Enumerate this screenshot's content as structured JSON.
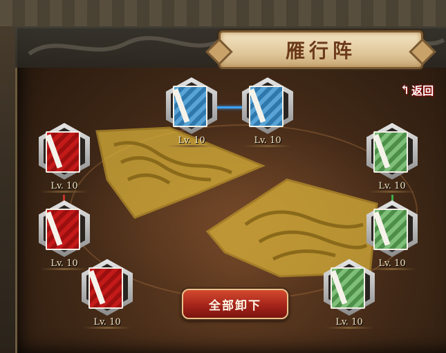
{
  "title": "雁行阵",
  "back": {
    "label": "返回",
    "icon": "curved-back-arrow"
  },
  "unequip_all_label": "全部卸下",
  "colors": {
    "red": "#c41a1a",
    "blue": "#3d8cc4",
    "green": "#5ea359",
    "gold": "#d9b13a"
  },
  "slots": [
    {
      "color": "blue",
      "level": "Lv. 10"
    },
    {
      "color": "blue",
      "level": "Lv. 10"
    },
    {
      "color": "red",
      "level": "Lv. 10"
    },
    {
      "color": "red",
      "level": "Lv. 10"
    },
    {
      "color": "red",
      "level": "Lv. 10"
    },
    {
      "color": "green",
      "level": "Lv. 10"
    },
    {
      "color": "green",
      "level": "Lv. 10"
    },
    {
      "color": "green",
      "level": "Lv. 10"
    }
  ]
}
